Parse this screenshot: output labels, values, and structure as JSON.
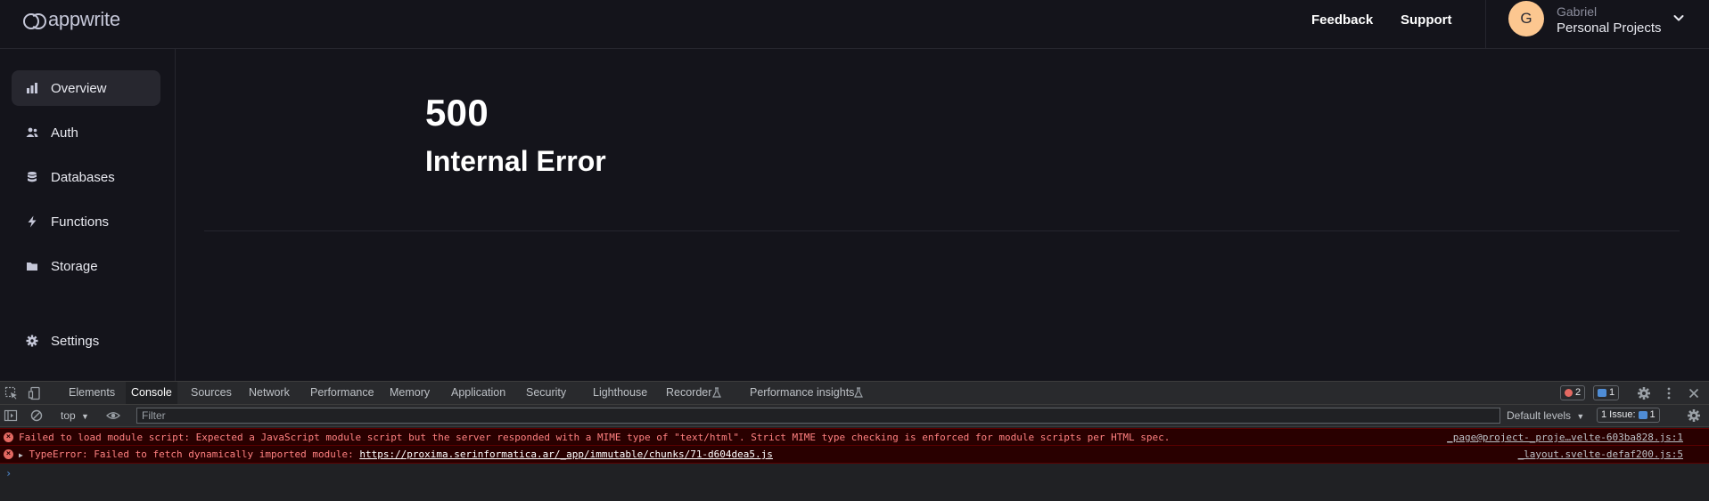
{
  "header": {
    "logo_text": "appwrite",
    "feedback_label": "Feedback",
    "support_label": "Support",
    "avatar_initial": "G",
    "user_name": "Gabriel",
    "project_name": "Personal Projects"
  },
  "sidebar": {
    "items": [
      {
        "label": "Overview",
        "icon": "chart-bar-icon",
        "active": true
      },
      {
        "label": "Auth",
        "icon": "users-icon"
      },
      {
        "label": "Databases",
        "icon": "database-icon"
      },
      {
        "label": "Functions",
        "icon": "lightning-icon"
      },
      {
        "label": "Storage",
        "icon": "folder-icon"
      },
      {
        "label": "Settings",
        "icon": "gear-icon"
      }
    ]
  },
  "main": {
    "error_code": "500",
    "error_title": "Internal Error"
  },
  "devtools": {
    "tabs": [
      "Elements",
      "Console",
      "Sources",
      "Network",
      "Performance",
      "Memory",
      "Application",
      "Security",
      "Lighthouse",
      "Recorder",
      "Performance insights"
    ],
    "active_tab": "Console",
    "error_count": "2",
    "message_count": "1",
    "context": "top",
    "filter_placeholder": "Filter",
    "levels_label": "Default levels",
    "issues_label": "1 Issue:",
    "issues_count": "1",
    "messages": [
      {
        "text": "Failed to load module script: Expected a JavaScript module script but the server responded with a MIME type of \"text/html\". Strict MIME type checking is enforced for module scripts per HTML spec.",
        "source": "_page@project-_proje…velte-603ba828.js:1"
      },
      {
        "prefix": "TypeError: Failed to fetch dynamically imported module: ",
        "link": "https://proxima.serinformatica.ar/_app/immutable/chunks/71-d604dea5.js",
        "source": "_layout.svelte-defaf200.js:5"
      }
    ],
    "prompt": "›"
  },
  "colors": {
    "background": "#14141b",
    "active_nav": "#27272f",
    "avatar": "#fcc790",
    "console_error_bg": "#290000",
    "console_error_text": "#ff8080"
  }
}
